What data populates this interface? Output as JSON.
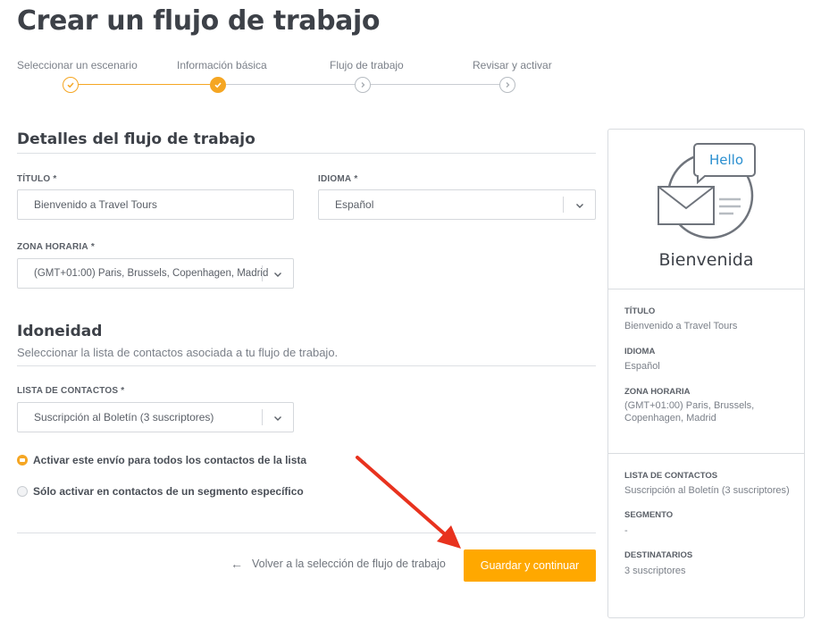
{
  "page": {
    "title": "Crear un flujo de trabajo"
  },
  "stepper": {
    "steps": [
      {
        "label": "Seleccionar un escenario",
        "state": "done"
      },
      {
        "label": "Información básica",
        "state": "active"
      },
      {
        "label": "Flujo de trabajo",
        "state": "todo"
      },
      {
        "label": "Revisar y activar",
        "state": "todo"
      }
    ]
  },
  "details": {
    "heading": "Detalles del flujo de trabajo",
    "title_label": "TÍTULO",
    "title_value": "Bienvenido a Travel Tours",
    "language_label": "IDIOMA",
    "language_value": "Español",
    "timezone_label": "ZONA HORARIA",
    "timezone_value": "(GMT+01:00) Paris, Brussels, Copenhagen, Madrid",
    "required_mark": "*"
  },
  "eligibility": {
    "heading": "Idoneidad",
    "subtitle": "Seleccionar la lista de contactos asociada a tu flujo de trabajo.",
    "list_label": "LISTA DE CONTACTOS",
    "list_value": "Suscripción al Boletín (3 suscriptores)",
    "options": [
      {
        "label": "Activar este envío para todos los contactos de la lista",
        "selected": true
      },
      {
        "label": "Sólo activar en contactos de un segmento específico",
        "selected": false
      }
    ]
  },
  "footer": {
    "back_label": "Volver a la selección de flujo de trabajo",
    "primary_label": "Guardar y continuar"
  },
  "summary": {
    "bubble_text": "Hello",
    "heading": "Bienvenida",
    "title_label": "TÍTULO",
    "title_value": "Bienvenido a Travel Tours",
    "language_label": "IDIOMA",
    "language_value": "Español",
    "timezone_label": "ZONA HORARIA",
    "timezone_value": "(GMT+01:00) Paris, Brussels, Copenhagen, Madrid",
    "list_label": "LISTA DE CONTACTOS",
    "list_value": "Suscripción al Boletín (3 suscriptores)",
    "segment_label": "SEGMENTO",
    "segment_value": "-",
    "recipients_label": "DESTINATARIOS",
    "recipients_value": "3 suscriptores"
  },
  "colors": {
    "accent": "#ffa800",
    "step": "#f5a623",
    "annotation": "#e8321e",
    "bubble_text": "#2a8fd0"
  },
  "icons": {
    "step_done": "check-icon",
    "step_todo": "chevron-right-icon",
    "select": "chevron-down-icon",
    "back": "arrow-left-icon",
    "illustration": "envelope-speech-bubble-icon"
  }
}
